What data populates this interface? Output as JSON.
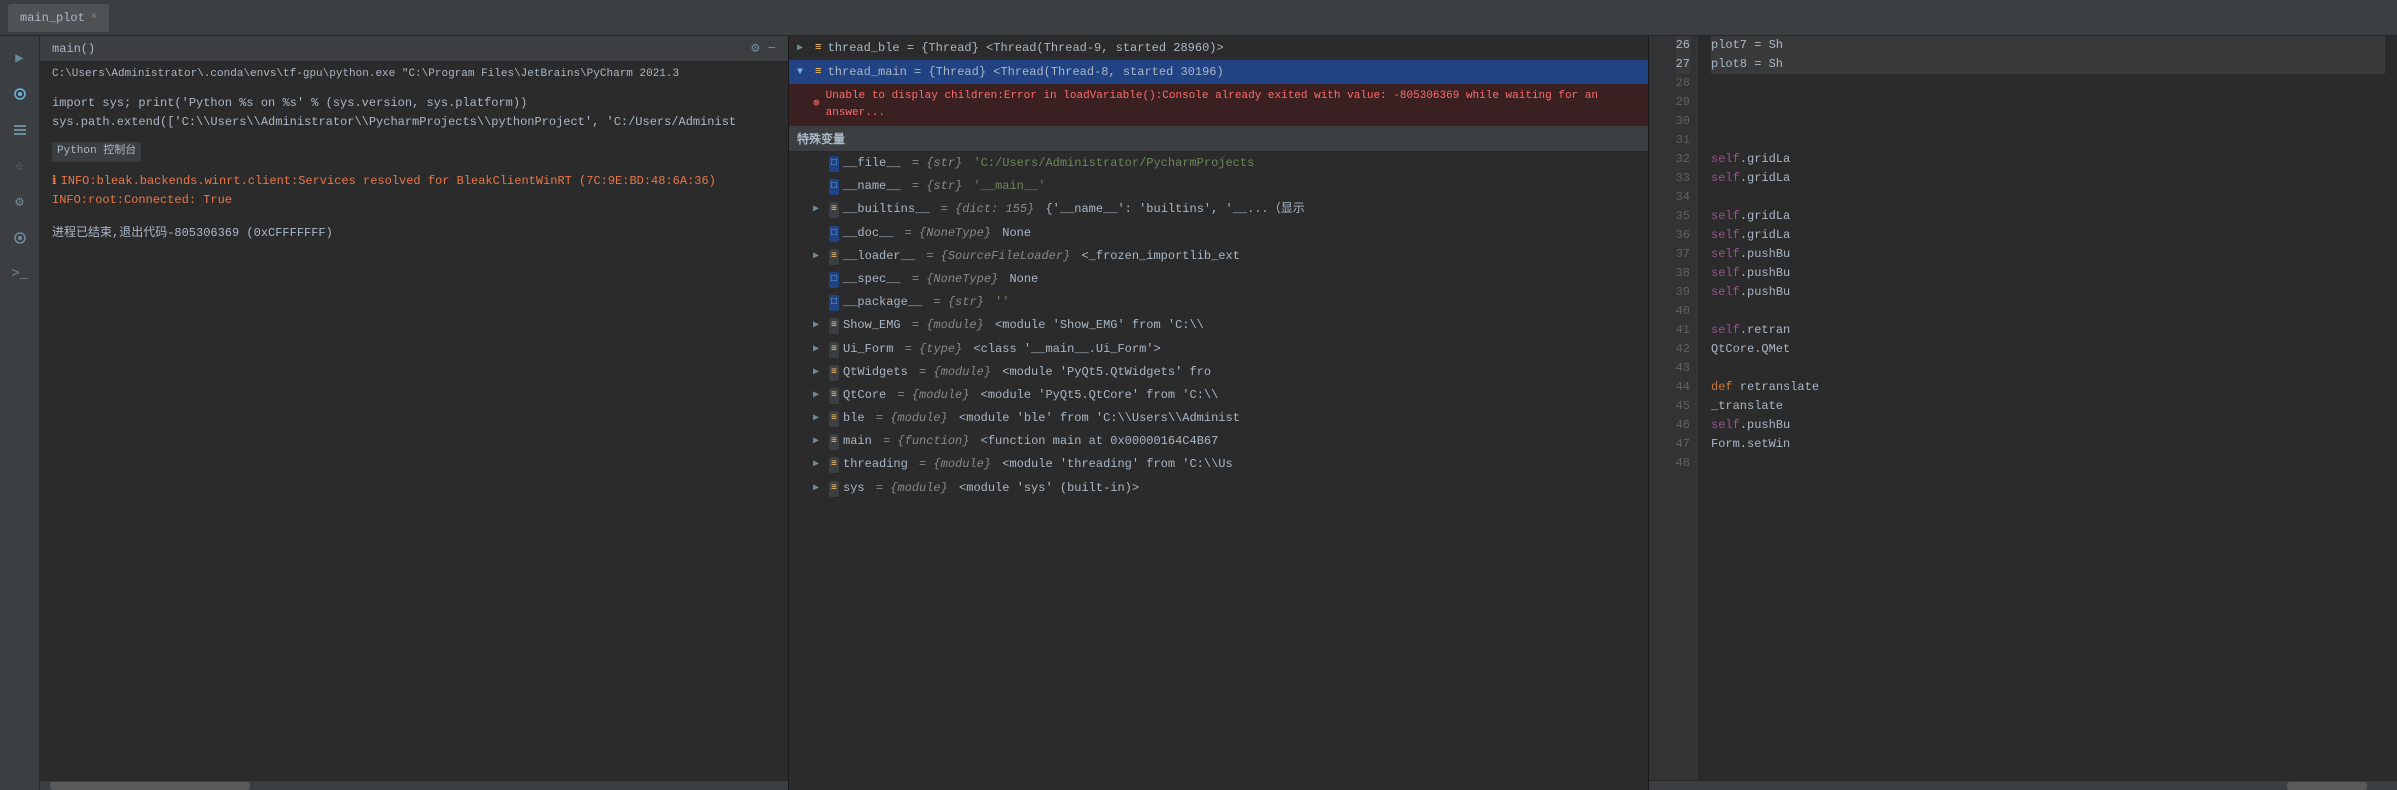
{
  "tab": {
    "label": "main_plot",
    "close": "×"
  },
  "console": {
    "title": "main()",
    "path": "C:\\Users\\Administrator\\.conda\\envs\\tf-gpu\\python.exe \"C:\\Program Files\\JetBrains\\PyCharm 2021.3",
    "lines": [
      {
        "type": "code",
        "text": "import sys; print('Python %s on %s' % (sys.version, sys.platform))"
      },
      {
        "type": "code",
        "text": "sys.path.extend(['C:\\\\Users\\\\Administrator\\\\PycharmProjects\\\\pythonProject', 'C:/Users/Administ"
      },
      {
        "type": "blank",
        "text": ""
      },
      {
        "type": "label",
        "label": "Python 控制台"
      },
      {
        "type": "blank",
        "text": ""
      },
      {
        "type": "info-orange",
        "text": "INFO:bleak.backends.winrt.client:Services resolved for BleakClientWinRT (7C:9E:BD:48:6A:36)"
      },
      {
        "type": "info-orange",
        "text": "INFO:root:Connected: True"
      },
      {
        "type": "blank",
        "text": ""
      },
      {
        "type": "exit",
        "text": "进程已结束,退出代码-805306369 (0xCFFFFFFF)"
      }
    ]
  },
  "debugger": {
    "threads": [
      {
        "id": "thread_ble",
        "label": "thread_ble = {Thread} <Thread(Thread-9, started 28960)>",
        "expanded": false,
        "selected": false
      },
      {
        "id": "thread_main",
        "label": "thread_main = {Thread} <Thread(Thread-8, started 30196)",
        "expanded": true,
        "selected": true
      }
    ],
    "error": "Unable to display children:Error in loadVariable():Console already exited with value: -805306369 while waiting for an answer...",
    "variables_header": "特殊变量",
    "variables": [
      {
        "name": "__file__",
        "type": "str",
        "value": "'C:/Users/Administrator/PycharmProjects",
        "icon": "□",
        "expandable": false
      },
      {
        "name": "__name__",
        "type": "str",
        "value": "'__main__'",
        "icon": "□",
        "expandable": false
      },
      {
        "name": "__builtins__",
        "type": "dict: 155",
        "value": "{'__name__': 'builtins', '__...（显示",
        "icon": "≡",
        "expandable": true
      },
      {
        "name": "__doc__",
        "type": "NoneType",
        "value": "None",
        "icon": "□",
        "expandable": false
      },
      {
        "name": "__loader__",
        "type": "SourceFileLoader",
        "value": "<_frozen_importlib_ext",
        "icon": "≡",
        "expandable": true
      },
      {
        "name": "__spec__",
        "type": "NoneType",
        "value": "None",
        "icon": "□",
        "expandable": false
      },
      {
        "name": "__package__",
        "type": "str",
        "value": "''",
        "icon": "□",
        "expandable": false
      },
      {
        "name": "Show_EMG",
        "type": "module",
        "value": "<module 'Show_EMG' from 'C:\\",
        "icon": "≡",
        "expandable": true
      },
      {
        "name": "Ui_Form",
        "type": "type",
        "value": "<class '__main__.Ui_Form'>",
        "icon": "≡",
        "expandable": true
      },
      {
        "name": "QtWidgets",
        "type": "module",
        "value": "<module 'PyQt5.QtWidgets' fro",
        "icon": "≡",
        "expandable": true
      },
      {
        "name": "QtCore",
        "type": "module",
        "value": "<module 'PyQt5.QtCore' from 'C:\\",
        "icon": "≡",
        "expandable": true
      },
      {
        "name": "ble",
        "type": "module",
        "value": "<module 'ble' from 'C:\\Users\\Administ",
        "icon": "≡",
        "expandable": true
      },
      {
        "name": "main",
        "type": "function",
        "value": "<function main at 0x00000164C4B67",
        "icon": "≡",
        "expandable": true
      },
      {
        "name": "threading",
        "type": "module",
        "value": "<module 'threading' from 'C:\\Us",
        "icon": "≡",
        "expandable": true
      },
      {
        "name": "sys",
        "type": "module",
        "value": "<module 'sys' (built-in)>",
        "icon": "≡",
        "expandable": true
      }
    ]
  },
  "code": {
    "lines": [
      {
        "num": 26,
        "text": "        plot7 = Sh",
        "highlight": true
      },
      {
        "num": 27,
        "text": "        plot8 = Sh",
        "highlight": true
      },
      {
        "num": 28,
        "text": ""
      },
      {
        "num": 29,
        "text": ""
      },
      {
        "num": 30,
        "text": ""
      },
      {
        "num": 31,
        "text": ""
      },
      {
        "num": 32,
        "text": "        self.gridLa"
      },
      {
        "num": 33,
        "text": "        self.gridLa"
      },
      {
        "num": 34,
        "text": ""
      },
      {
        "num": 35,
        "text": "        self.gridLa"
      },
      {
        "num": 36,
        "text": "        self.gridLa"
      },
      {
        "num": 37,
        "text": "        self.pushBu"
      },
      {
        "num": 38,
        "text": "        self.pushBu"
      },
      {
        "num": 39,
        "text": "        self.pushBu"
      },
      {
        "num": 40,
        "text": ""
      },
      {
        "num": 41,
        "text": "        self.retran"
      },
      {
        "num": 42,
        "text": "        QtCore.QMet"
      },
      {
        "num": 43,
        "text": ""
      },
      {
        "num": 44,
        "text": "    def retranslate"
      },
      {
        "num": 45,
        "text": "        _translate"
      },
      {
        "num": 46,
        "text": "        self.pushBu"
      },
      {
        "num": 47,
        "text": "        Form.setWin"
      },
      {
        "num": 48,
        "text": ""
      }
    ]
  },
  "sidebar_icons": [
    {
      "name": "run-icon",
      "symbol": "▶",
      "active": false
    },
    {
      "name": "debug-icon",
      "symbol": "🐛",
      "active": false
    },
    {
      "name": "structure-icon",
      "symbol": "≡",
      "active": false
    },
    {
      "name": "bookmark-icon",
      "symbol": "☆",
      "active": false
    },
    {
      "name": "terminal-icon",
      "symbol": ">_",
      "active": false
    },
    {
      "name": "python-icon",
      "symbol": "Py",
      "active": false
    },
    {
      "name": "expand-icon",
      "symbol": "»",
      "active": false
    }
  ]
}
